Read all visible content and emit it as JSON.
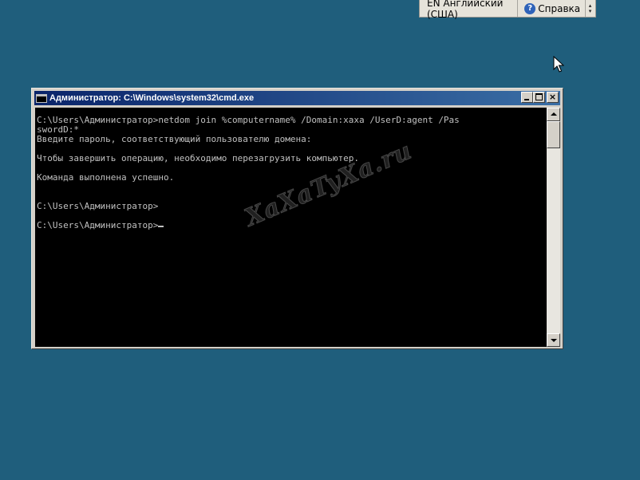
{
  "langbar": {
    "language": "EN Английский (США)",
    "help_label": "Справка",
    "help_icon": "question-icon",
    "options_icon": "chevron-updown-icon"
  },
  "window": {
    "title": "Администратор: C:\\Windows\\system32\\cmd.exe",
    "close_glyph": "×"
  },
  "console": {
    "lines": [
      "C:\\Users\\Администратор>netdom join %computername% /Domain:xaxa /UserD:agent /Pas",
      "swordD:*",
      "Введите пароль, соответствующий пользователю домена:",
      "",
      "Чтобы завершить операцию, необходимо перезагрузить компьютер.",
      "",
      "Команда выполнена успешно.",
      "",
      "",
      "C:\\Users\\Администратор>",
      "",
      "C:\\Users\\Администратор>"
    ]
  },
  "watermark": "XaXaTyXa.ru",
  "colors": {
    "desktop": "#1f5e7c",
    "titlebar_start": "#0a246a",
    "titlebar_end": "#3a6ea5",
    "console_bg": "#000000",
    "console_fg": "#c0c0c0"
  }
}
